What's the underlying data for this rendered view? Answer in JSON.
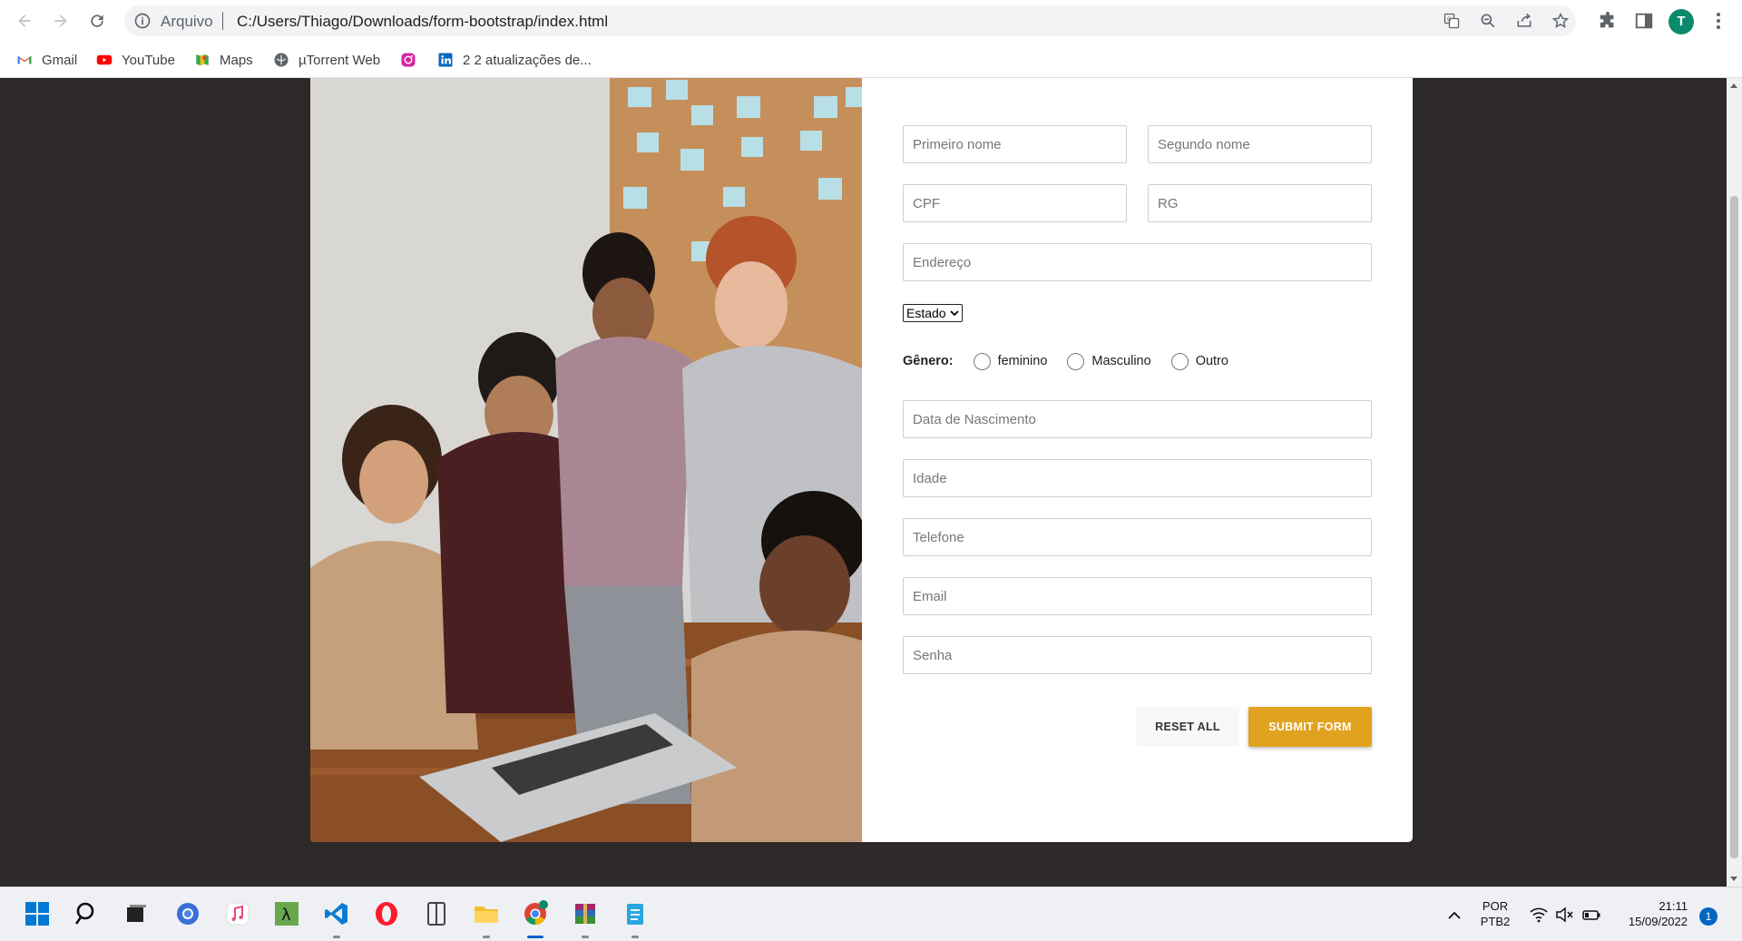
{
  "browser": {
    "scheme_label": "Arquivo",
    "url": "C:/Users/Thiago/Downloads/form-bootstrap/index.html",
    "profile_initial": "T"
  },
  "bookmarks": [
    {
      "label": "Gmail",
      "icon": "gmail-icon"
    },
    {
      "label": "YouTube",
      "icon": "youtube-icon"
    },
    {
      "label": "Maps",
      "icon": "maps-icon"
    },
    {
      "label": "µTorrent Web",
      "icon": "utorrent-icon"
    },
    {
      "label": "",
      "icon": "instagram-icon"
    },
    {
      "label": "2 2 atualizações de...",
      "icon": "linkedin-icon"
    }
  ],
  "form": {
    "first_name": {
      "placeholder": "Primeiro nome"
    },
    "last_name": {
      "placeholder": "Segundo nome"
    },
    "cpf": {
      "placeholder": "CPF"
    },
    "rg": {
      "placeholder": "RG"
    },
    "address": {
      "placeholder": "Endereço"
    },
    "state_select": {
      "selected": "Estado"
    },
    "gender": {
      "label": "Gênero:",
      "options": [
        "feminino",
        "Masculino",
        "Outro"
      ]
    },
    "birth_date": {
      "placeholder": "Data de Nascimento"
    },
    "age": {
      "placeholder": "Idade"
    },
    "phone": {
      "placeholder": "Telefone"
    },
    "email": {
      "placeholder": "Email"
    },
    "password": {
      "placeholder": "Senha"
    },
    "reset_label": "Reset all",
    "submit_label": "Submit form"
  },
  "colors": {
    "page_background": "#2c2928",
    "submit_button": "#e0a21f",
    "reset_button": "#f8f8f8"
  },
  "taskbar": {
    "apps": [
      "windows-start-icon",
      "search-icon",
      "task-view-icon",
      "chrome-canary-icon",
      "itunes-icon",
      "lambda-app-icon",
      "vscode-icon",
      "opera-icon",
      "reader-icon",
      "file-explorer-icon",
      "chrome-icon",
      "winrar-icon",
      "notepad-icon"
    ],
    "lang_top": "POR",
    "lang_bottom": "PTB2",
    "time": "21:11",
    "date": "15/09/2022",
    "notification_count": "1"
  }
}
